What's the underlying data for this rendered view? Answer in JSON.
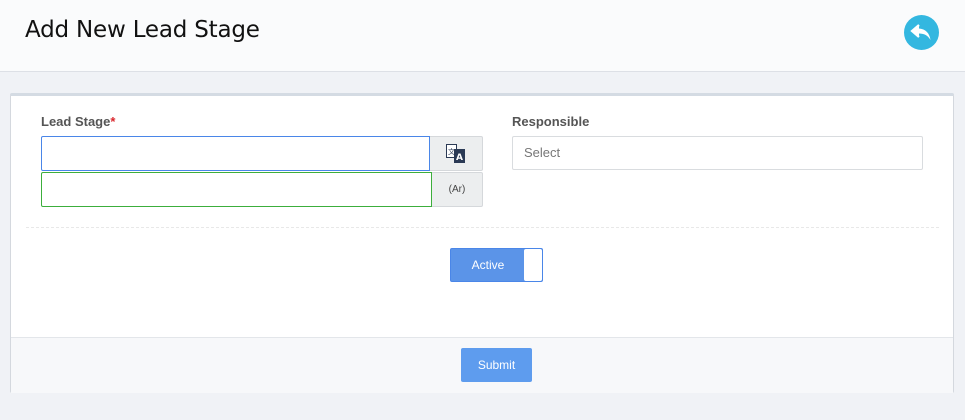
{
  "header": {
    "title": "Add New Lead Stage",
    "back_icon": "reply-all-icon",
    "accent_color": "#33b7e0"
  },
  "form": {
    "lead_stage": {
      "label": "Lead Stage",
      "required_mark": "*",
      "value_en": "",
      "value_ar": "",
      "translate_icon": "translate-icon",
      "ar_addon": "(Ar)"
    },
    "responsible": {
      "label": "Responsible",
      "selected": "Select"
    },
    "active_toggle": {
      "label": "Active",
      "state": "on"
    },
    "submit_label": "Submit"
  },
  "colors": {
    "primary_button": "#5e9cee",
    "focus_border": "#4a86e8",
    "success_border": "#3cae3c",
    "required": "#d9262c"
  }
}
